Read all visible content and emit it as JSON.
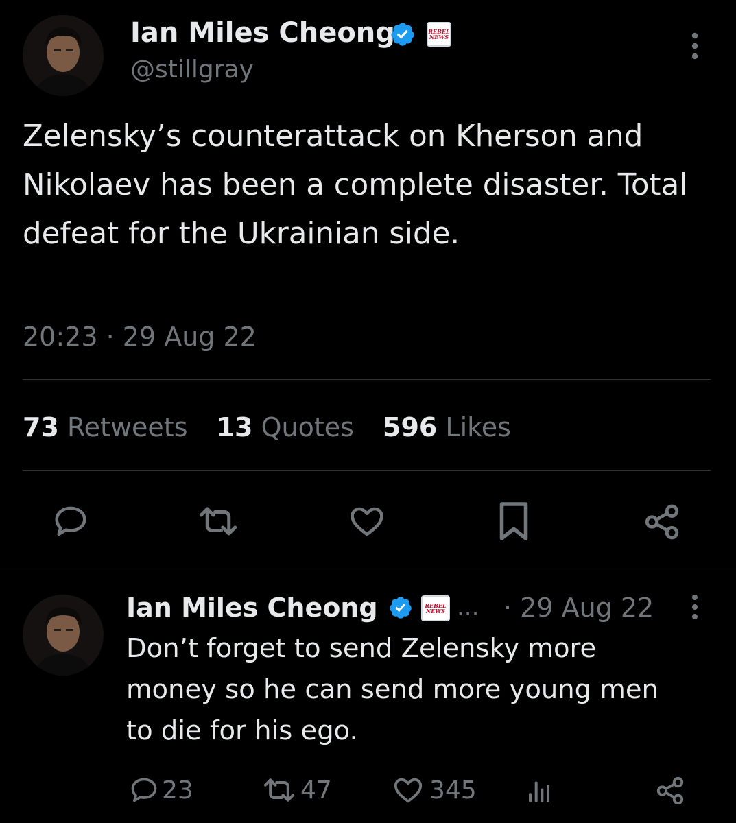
{
  "main_tweet": {
    "author_name": "Ian Miles Cheong",
    "handle": "@stillgray",
    "affiliate_badge": "REBEL NEWS",
    "text": "Zelensky’s counterattack on Kherson and Nikolaev has been a complete disaster. Total defeat for the Ukrainian side.",
    "time": "20:23",
    "separator": "·",
    "date": "29 Aug 22",
    "stats": {
      "retweets_count": "73",
      "retweets_label": "Retweets",
      "quotes_count": "13",
      "quotes_label": "Quotes",
      "likes_count": "596",
      "likes_label": "Likes"
    },
    "actions": [
      "reply-icon",
      "retweet-icon",
      "like-icon",
      "bookmark-icon",
      "share-icon"
    ]
  },
  "reply_tweet": {
    "author_name": "Ian Miles Cheong",
    "affiliate_badge": "REBEL NEWS",
    "ellipsis": "...",
    "date": "· 29 Aug 22",
    "text_lines": [
      "Don’t forget to send Zelensky more",
      "money so he can send more young men",
      "to die for his ego."
    ],
    "replies": "23",
    "retweets": "47",
    "likes": "345"
  },
  "colors": {
    "background": "#000000",
    "text_primary": "#e7e9ea",
    "text_secondary": "#71767b",
    "verified_blue": "#1d9bf0",
    "divider": "#2f3336"
  }
}
